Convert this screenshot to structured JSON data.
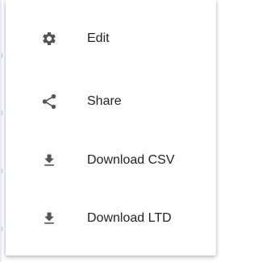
{
  "menu": {
    "items": [
      {
        "label": "Edit",
        "icon": "gear-icon"
      },
      {
        "label": "Share",
        "icon": "share-icon"
      },
      {
        "label": "Download CSV",
        "icon": "download-icon"
      },
      {
        "label": "Download LTD",
        "icon": "download-icon"
      }
    ]
  },
  "colors": {
    "icon": "#555555",
    "text": "#222222",
    "menu_background": "#ffffff"
  }
}
